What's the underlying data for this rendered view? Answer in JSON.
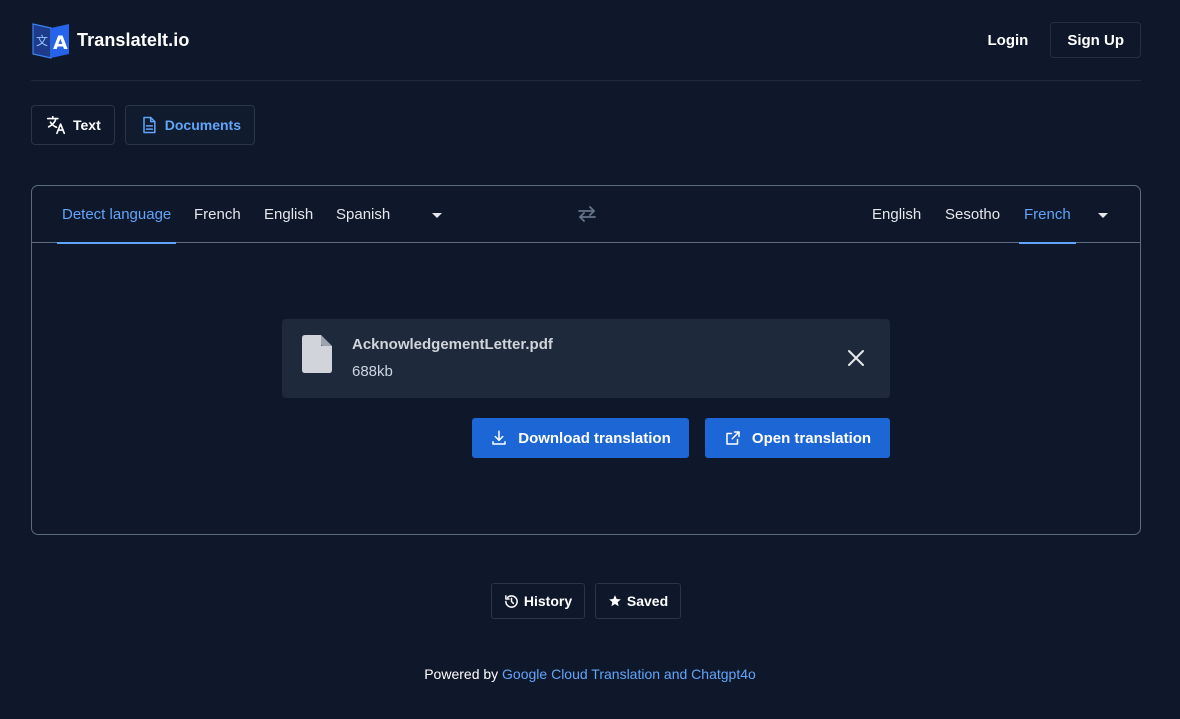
{
  "brand": {
    "name": "TranslateIt.io",
    "logo_icon": "translate-book-icon",
    "logo_glyphs": [
      "文",
      "A"
    ]
  },
  "auth": {
    "login_label": "Login",
    "signup_label": "Sign Up"
  },
  "modes": [
    {
      "label": "Text",
      "icon": "translate-icon",
      "active": false
    },
    {
      "label": "Documents",
      "icon": "document-icon",
      "active": true
    }
  ],
  "translator": {
    "source_languages": [
      {
        "label": "Detect language",
        "active": true
      },
      {
        "label": "French",
        "active": false
      },
      {
        "label": "English",
        "active": false
      },
      {
        "label": "Spanish",
        "active": false
      }
    ],
    "target_languages": [
      {
        "label": "English",
        "active": false
      },
      {
        "label": "Sesotho",
        "active": false
      },
      {
        "label": "French",
        "active": true
      }
    ],
    "swap_icon": "swap-arrows-icon"
  },
  "file": {
    "name": "AcknowledgementLetter.pdf",
    "size": "688kb"
  },
  "actions": {
    "download_label": "Download translation",
    "open_label": "Open translation"
  },
  "bottom": {
    "history_label": "History",
    "saved_label": "Saved"
  },
  "footer": {
    "prefix": "Powered by",
    "link_text": "Google Cloud Translation and Chatgpt4o"
  },
  "colors": {
    "background": "#0f172a",
    "accent": "#60a5fa",
    "primary_button": "#1d66d6",
    "card": "#1e293b"
  }
}
